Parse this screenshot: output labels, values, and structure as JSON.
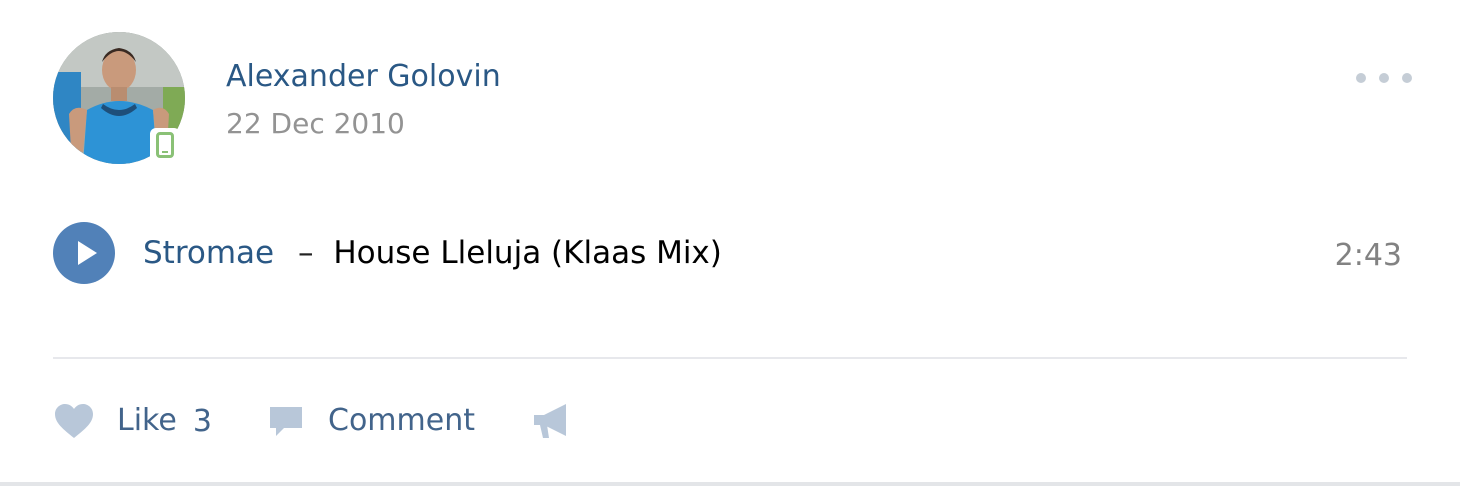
{
  "post": {
    "author": "Alexander Golovin",
    "date": "22 Dec 2010"
  },
  "audio": {
    "artist": "Stromae",
    "separator": "–",
    "title": "House Lleluja (Klaas Mix)",
    "duration": "2:43"
  },
  "actions": {
    "like_label": "Like",
    "like_count": "3",
    "comment_label": "Comment"
  },
  "icons": {
    "more": "more-dots-icon",
    "play": "play-icon",
    "like": "heart-icon",
    "comment": "comment-bubble-icon",
    "share": "megaphone-icon",
    "mobile": "mobile-phone-icon"
  },
  "colors": {
    "link": "#2a5885",
    "accent": "#5181b8",
    "muted": "#939393",
    "action_icon": "#a9bdd3",
    "online_mobile": "#8ac176"
  }
}
